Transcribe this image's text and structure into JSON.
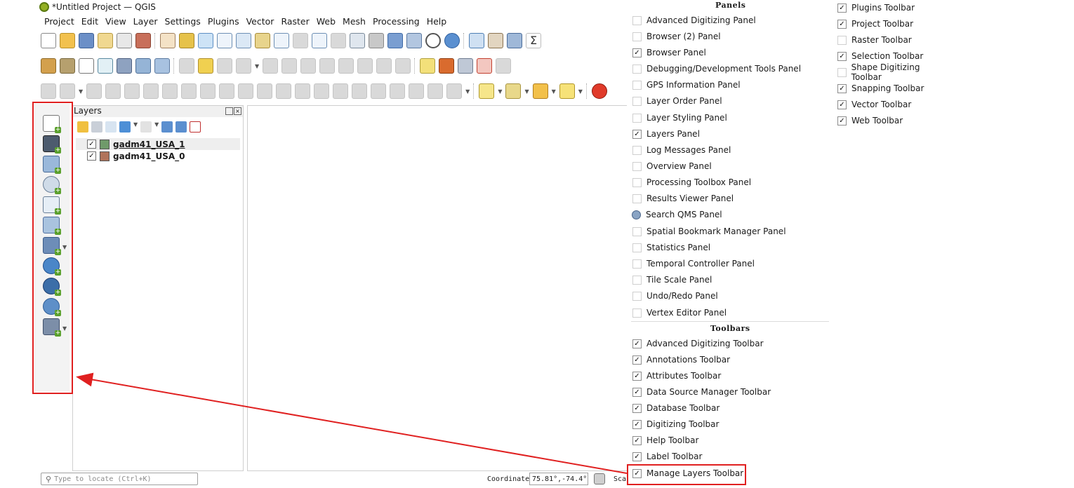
{
  "window": {
    "title": "*Untitled Project — QGIS"
  },
  "menubar": [
    "Project",
    "Edit",
    "View",
    "Layer",
    "Settings",
    "Plugins",
    "Vector",
    "Raster",
    "Web",
    "Mesh",
    "Processing",
    "Help"
  ],
  "layers_panel": {
    "title": "Layers",
    "layers": [
      {
        "name": "gadm41_USA_1",
        "checked": true,
        "color": "#6f9a6a"
      },
      {
        "name": "gadm41_USA_0",
        "checked": true,
        "color": "#b0735a"
      }
    ]
  },
  "statusbar": {
    "locator_placeholder": "Type to locate (Ctrl+K)",
    "coordinate_label": "Coordinate",
    "coordinate_value": "75.81°,-74.4°",
    "scale_label": "Sca"
  },
  "context_menu": {
    "panels_header": "Panels",
    "toolbars_header": "Toolbars",
    "panels": [
      {
        "label": "Advanced Digitizing Panel",
        "checked": false
      },
      {
        "label": "Browser (2) Panel",
        "checked": false
      },
      {
        "label": "Browser Panel",
        "checked": true
      },
      {
        "label": "Debugging/Development Tools Panel",
        "checked": false
      },
      {
        "label": "GPS Information Panel",
        "checked": false
      },
      {
        "label": "Layer Order Panel",
        "checked": false
      },
      {
        "label": "Layer Styling Panel",
        "checked": false
      },
      {
        "label": "Layers Panel",
        "checked": true
      },
      {
        "label": "Log Messages Panel",
        "checked": false
      },
      {
        "label": "Overview Panel",
        "checked": false
      },
      {
        "label": "Processing Toolbox Panel",
        "checked": false
      },
      {
        "label": "Results Viewer Panel",
        "checked": false
      },
      {
        "label": "Search QMS Panel",
        "checked": false,
        "icon": "globe-icon"
      },
      {
        "label": "Spatial Bookmark Manager Panel",
        "checked": false
      },
      {
        "label": "Statistics Panel",
        "checked": false
      },
      {
        "label": "Temporal Controller Panel",
        "checked": false
      },
      {
        "label": "Tile Scale Panel",
        "checked": false
      },
      {
        "label": "Undo/Redo Panel",
        "checked": false
      },
      {
        "label": "Vertex Editor Panel",
        "checked": false
      }
    ],
    "toolbars": [
      {
        "label": "Advanced Digitizing Toolbar",
        "checked": true
      },
      {
        "label": "Annotations Toolbar",
        "checked": true
      },
      {
        "label": "Attributes Toolbar",
        "checked": true
      },
      {
        "label": "Data Source Manager Toolbar",
        "checked": true
      },
      {
        "label": "Database Toolbar",
        "checked": true
      },
      {
        "label": "Digitizing Toolbar",
        "checked": true
      },
      {
        "label": "Help Toolbar",
        "checked": true
      },
      {
        "label": "Label Toolbar",
        "checked": true
      },
      {
        "label": "Manage Layers Toolbar",
        "checked": true
      }
    ],
    "toolbars_col2": [
      {
        "label": "Plugins Toolbar",
        "checked": true
      },
      {
        "label": "Project Toolbar",
        "checked": true
      },
      {
        "label": "Raster Toolbar",
        "checked": false
      },
      {
        "label": "Selection Toolbar",
        "checked": true
      },
      {
        "label": "Shape Digitizing Toolbar",
        "checked": false
      },
      {
        "label": "Snapping Toolbar",
        "checked": true
      },
      {
        "label": "Vector Toolbar",
        "checked": true
      },
      {
        "label": "Web Toolbar",
        "checked": true
      }
    ]
  },
  "colors": {
    "annotation_red": "#e02020",
    "check_mark": "✓"
  }
}
